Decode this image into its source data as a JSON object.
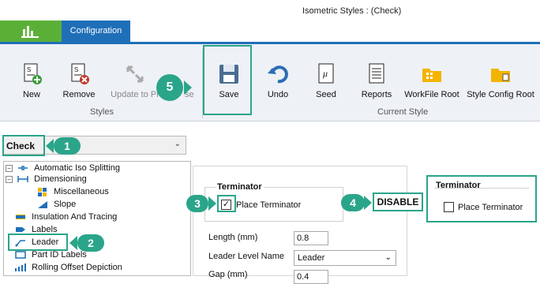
{
  "window": {
    "title": "Isometric Styles : (Check)"
  },
  "tabs": {
    "config": "Configuration"
  },
  "ribbon": {
    "buttons": [
      {
        "label": "New",
        "icon": "new-doc-icon"
      },
      {
        "label": "Remove",
        "icon": "remove-doc-icon"
      },
      {
        "label": "Update to Pr",
        "icon": "update-icon",
        "disabled": true
      },
      {
        "label": "se",
        "icon": ""
      },
      {
        "label": "Save",
        "icon": "save-icon"
      },
      {
        "label": "Undo",
        "icon": "undo-icon"
      },
      {
        "label": "Seed",
        "icon": "seed-icon"
      },
      {
        "label": "Reports",
        "icon": "reports-icon"
      },
      {
        "label": "WorkFile Root",
        "icon": "folder-icon"
      },
      {
        "label": "Style Config Root",
        "icon": "folder-config-icon"
      }
    ],
    "group_styles": "Styles",
    "group_current": "Current Style"
  },
  "style_selector": {
    "value": "Check"
  },
  "tree": {
    "items": [
      {
        "label": "Automatic Iso Splitting"
      },
      {
        "label": "Dimensioning"
      },
      {
        "label": "Miscellaneous"
      },
      {
        "label": "Slope"
      },
      {
        "label": "Insulation And Tracing"
      },
      {
        "label": "Labels"
      },
      {
        "label": "Leader"
      },
      {
        "label": "Part ID Labels"
      },
      {
        "label": "Rolling Offset Depiction"
      }
    ]
  },
  "terminator": {
    "title": "Terminator",
    "place_label": "Place Terminator",
    "checked_mark": "✓"
  },
  "fields": {
    "length_label": "Length (mm)",
    "length_value": "0.8",
    "level_label": "Leader Level Name",
    "level_value": "Leader",
    "gap_label": "Gap (mm)",
    "gap_value": "0.4"
  },
  "callouts": {
    "n1": "1",
    "n2": "2",
    "n3": "3",
    "n4": "4",
    "n5": "5",
    "disable": "DISABLE"
  },
  "inset": {
    "title": "Terminator",
    "place_label": "Place Terminator"
  },
  "colors": {
    "accent": "#2aa58a",
    "tab_blue": "#1f6fb8",
    "app_green": "#5ab037"
  }
}
